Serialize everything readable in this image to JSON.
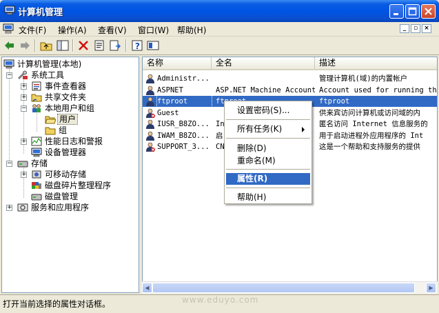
{
  "window": {
    "title": "计算机管理"
  },
  "menu": [
    "文件(F)",
    "操作(A)",
    "查看(V)",
    "窗口(W)",
    "帮助(H)"
  ],
  "tree": {
    "root": "计算机管理(本地)",
    "system_tools": "系统工具",
    "event_viewer": "事件查看器",
    "shared_folders": "共享文件夹",
    "local_users": "本地用户和组",
    "users": "用户",
    "groups": "组",
    "perf_logs": "性能日志和警报",
    "device_manager": "设备管理器",
    "storage": "存储",
    "removable": "可移动存储",
    "defrag": "磁盘碎片整理程序",
    "disk_mgmt": "磁盘管理",
    "services": "服务和应用程序"
  },
  "list": {
    "columns": [
      "名称",
      "全名",
      "描述"
    ],
    "rows": [
      {
        "name": "Administr...",
        "fullname": "",
        "desc": "管理计算机(域)的内置帐户",
        "selected": false
      },
      {
        "name": "ASPNET",
        "fullname": "ASP.NET Machine Account",
        "desc": "Account used for running the",
        "selected": false
      },
      {
        "name": "ftproot",
        "fullname": "ftproot",
        "desc": "ftproot",
        "selected": true
      },
      {
        "name": "Guest",
        "fullname": "",
        "desc": "供来宾访问计算机或访问域的内",
        "selected": false
      },
      {
        "name": "IUSR_B8ZO...",
        "fullname": "In",
        "desc": "匿名访问 Internet 信息服务的",
        "selected": false
      },
      {
        "name": "IWAM_B8ZO...",
        "fullname": "启",
        "desc": "用于启动进程外应用程序的 Int",
        "selected": false
      },
      {
        "name": "SUPPORT_3...",
        "fullname": "CN",
        "desc": "这是一个帮助和支持服务的提供",
        "selected": false
      }
    ]
  },
  "context_menu": {
    "set_password": "设置密码(S)...",
    "all_tasks": "所有任务(K)",
    "delete": "删除(D)",
    "rename": "重命名(M)",
    "properties": "属性(R)",
    "help": "帮助(H)"
  },
  "status": "打开当前选择的属性对话框。",
  "watermark": "www.eduyo.com",
  "colors": {
    "title_blue": "#0054e3",
    "selection": "#316ac5",
    "chrome": "#ece9d8"
  }
}
